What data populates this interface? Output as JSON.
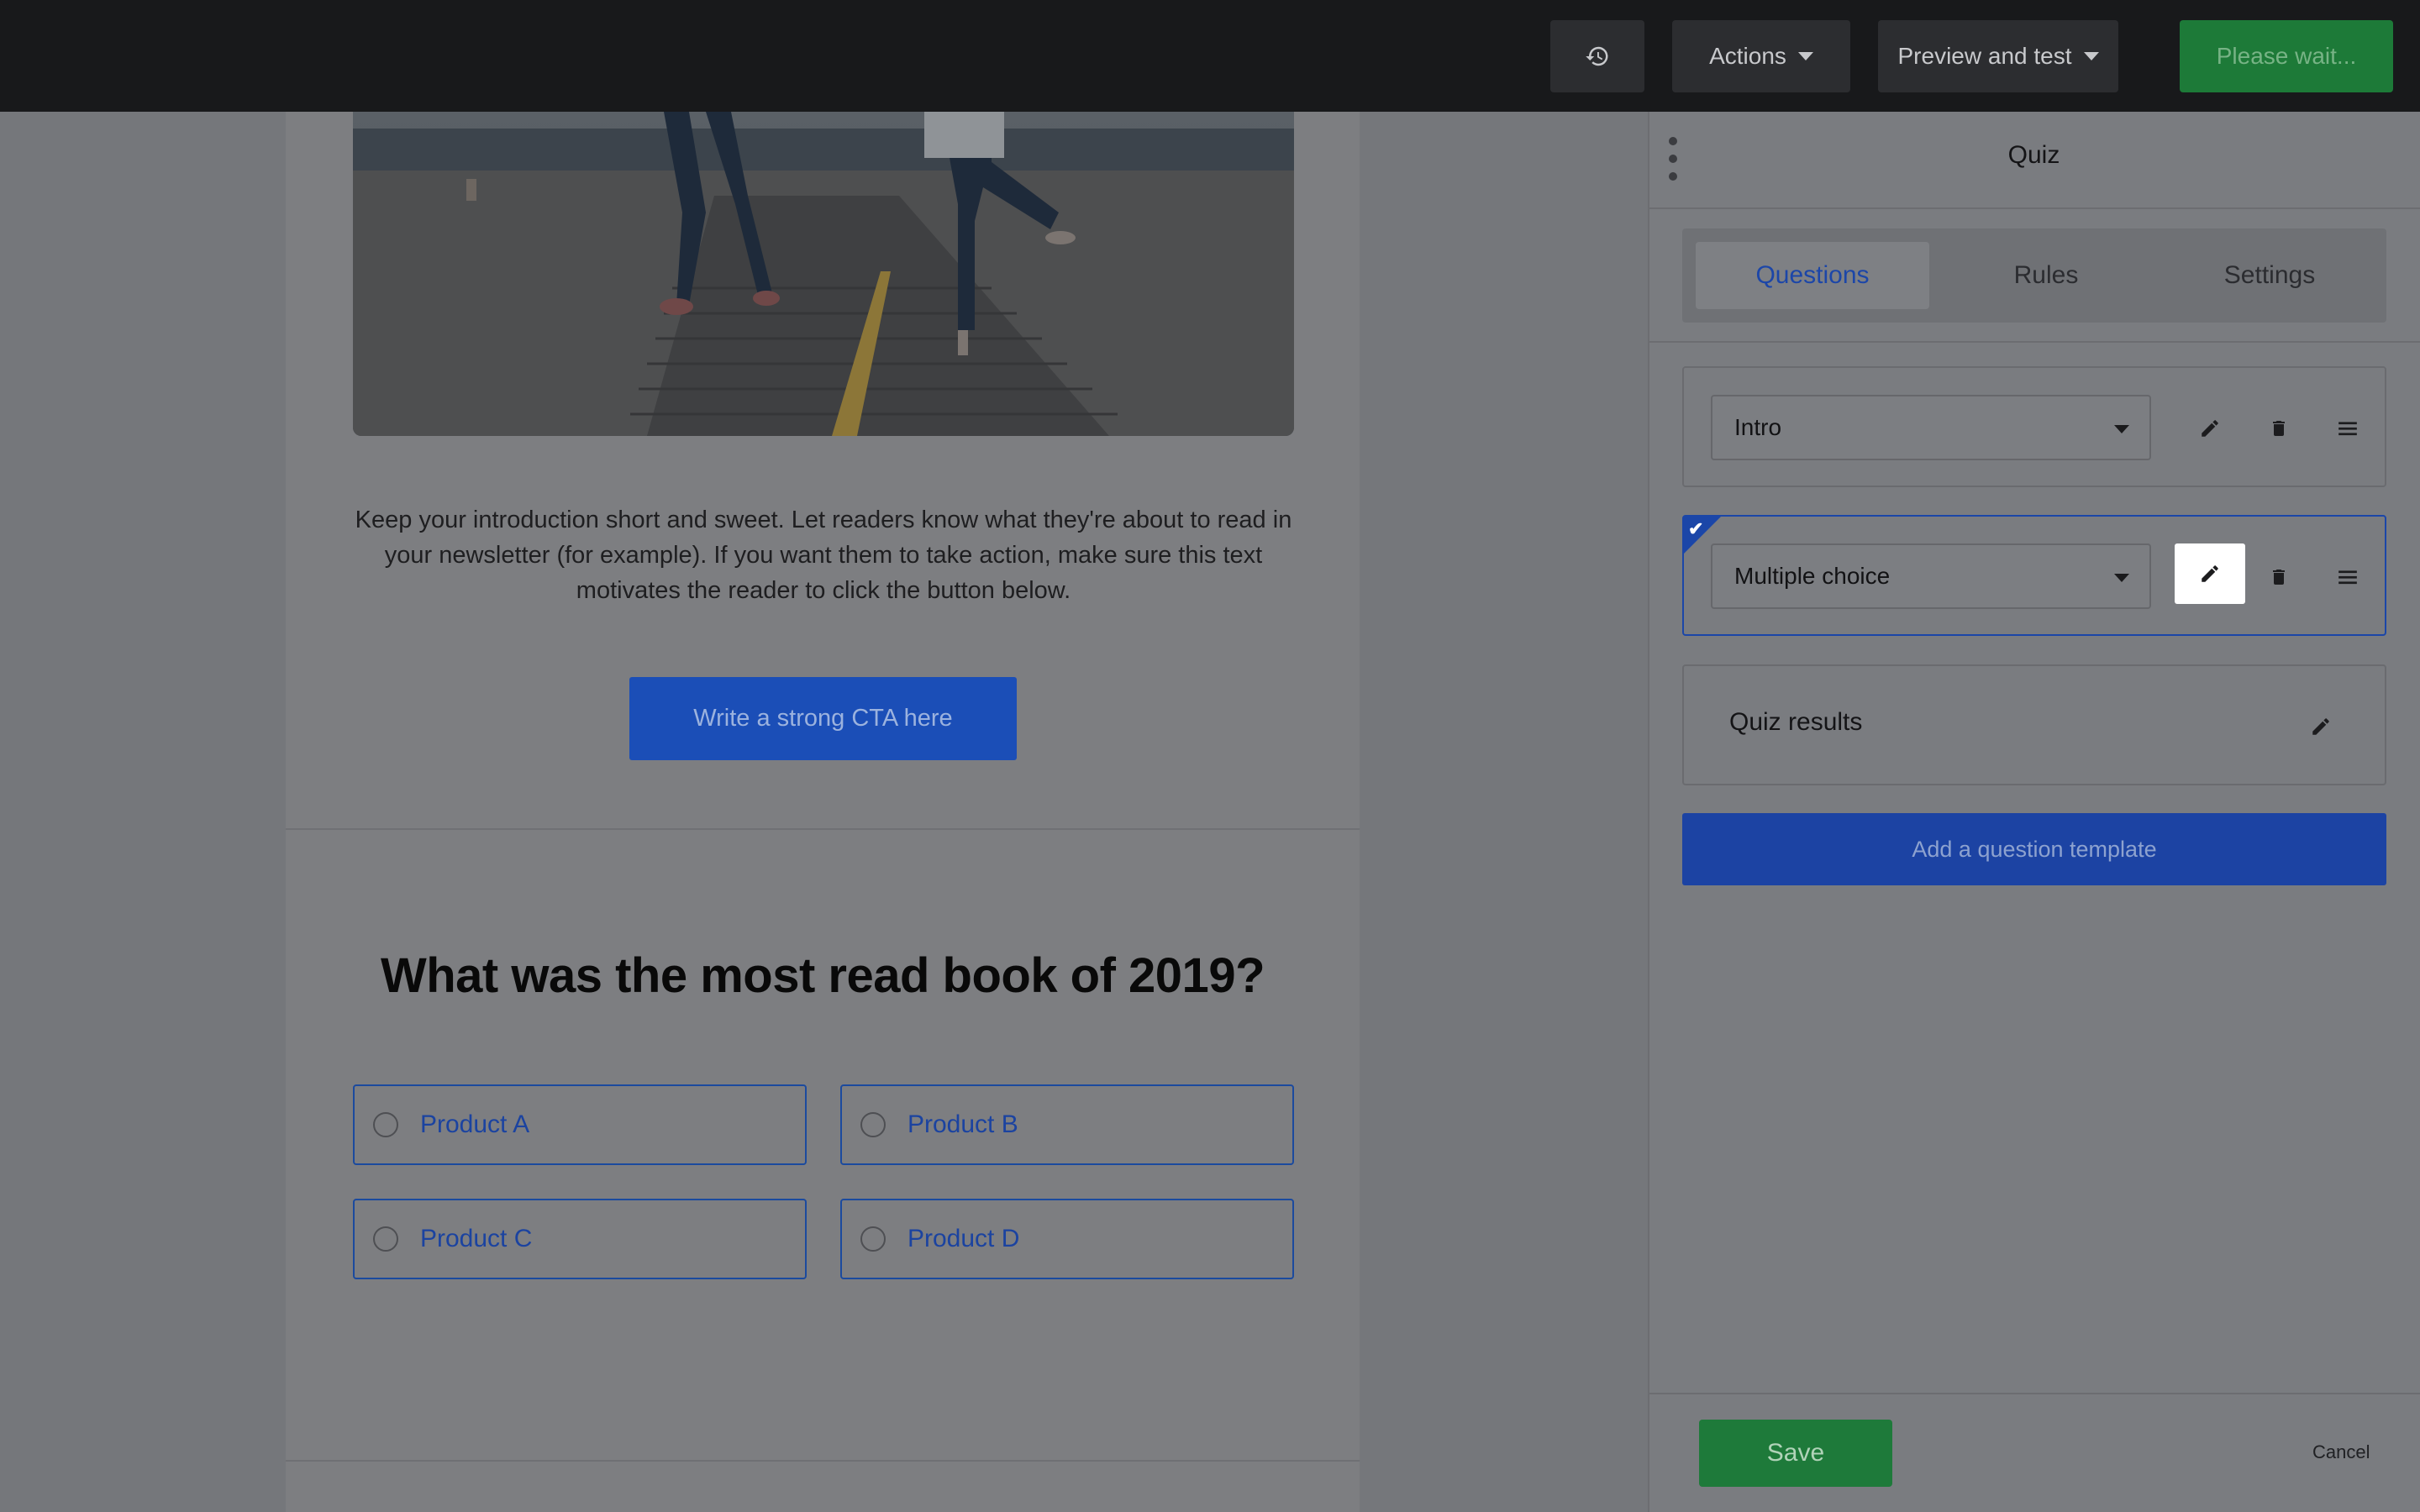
{
  "topbar": {
    "history_icon": "history-icon",
    "actions_label": "Actions",
    "preview_label": "Preview and test",
    "wait_label": "Please wait..."
  },
  "email": {
    "intro_text": "Keep your introduction short and sweet. Let readers know what they're about to read in your newsletter (for example). If you want them to take action, make sure this text motivates the reader to click the button below.",
    "cta_label": "Write a strong CTA here",
    "question_title": "What was the most read book of 2019?",
    "options": [
      "Product A",
      "Product B",
      "Product C",
      "Product D"
    ]
  },
  "panel": {
    "title": "Quiz",
    "tabs": [
      {
        "label": "Questions",
        "active": true
      },
      {
        "label": "Rules",
        "active": false
      },
      {
        "label": "Settings",
        "active": false
      }
    ],
    "questions": [
      {
        "type": "Intro",
        "selected": false
      },
      {
        "type": "Multiple choice",
        "selected": true
      }
    ],
    "results_label": "Quiz results",
    "add_button_label": "Add a question template",
    "save_label": "Save",
    "cancel_label": "Cancel"
  }
}
